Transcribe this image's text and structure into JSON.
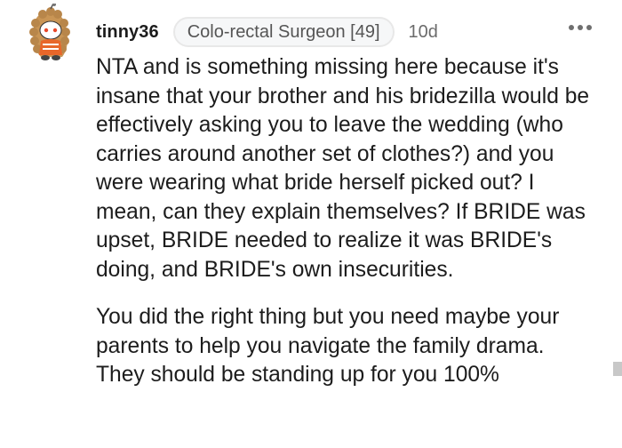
{
  "comment": {
    "username": "tinny36",
    "flair": "Colo-rectal Surgeon [49]",
    "timestamp": "10d",
    "avatar_icon": "user-avatar-icon",
    "more_icon": "more-options-icon",
    "paragraphs": [
      "NTA and is something missing here because it's insane that your brother and his bridezilla would be effectively asking you to leave the wedding (who carries around another set of clothes?) and you were wearing what bride herself picked out? I mean, can they explain themselves? If BRIDE was upset, BRIDE needed to realize it was BRIDE's doing, and BRIDE's own insecurities.",
      "You did the right thing but you need maybe your parents to help you navigate the family drama. They should be standing up for you 100%"
    ]
  },
  "colors": {
    "text": "#1c1c1c",
    "meta": "#6b6b6b",
    "flair_bg": "#f6f7f8",
    "avatar_hair": "#b8864a",
    "avatar_shirt": "#e8672a"
  }
}
